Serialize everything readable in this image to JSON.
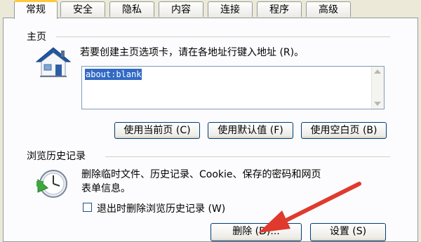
{
  "tabs": [
    "常规",
    "安全",
    "隐私",
    "内容",
    "连接",
    "程序",
    "高级"
  ],
  "home": {
    "title": "主页",
    "description": "若要创建主页选项卡，请在各地址行键入地址 (R)。",
    "url_value": "about:blank",
    "buttons": {
      "use_current": "使用当前页 (C)",
      "use_default": "使用默认值 (F)",
      "use_blank": "使用空白页 (B)"
    }
  },
  "history": {
    "title": "浏览历史记录",
    "description_line1": "删除临时文件、历史记录、Cookie、保存的密码和网页",
    "description_line2": "表单信息。",
    "checkbox_label": "退出时删除浏览历史记录 (W)",
    "checkbox_checked": false,
    "buttons": {
      "delete": "删除 (D)...",
      "settings": "设置 (S)"
    }
  },
  "colors": {
    "annotation_arrow": "#E03A2E",
    "dialog_bg": "#FCFCFE",
    "selection": "#316AC5"
  },
  "icons": [
    "home-icon",
    "history-clock-icon"
  ]
}
